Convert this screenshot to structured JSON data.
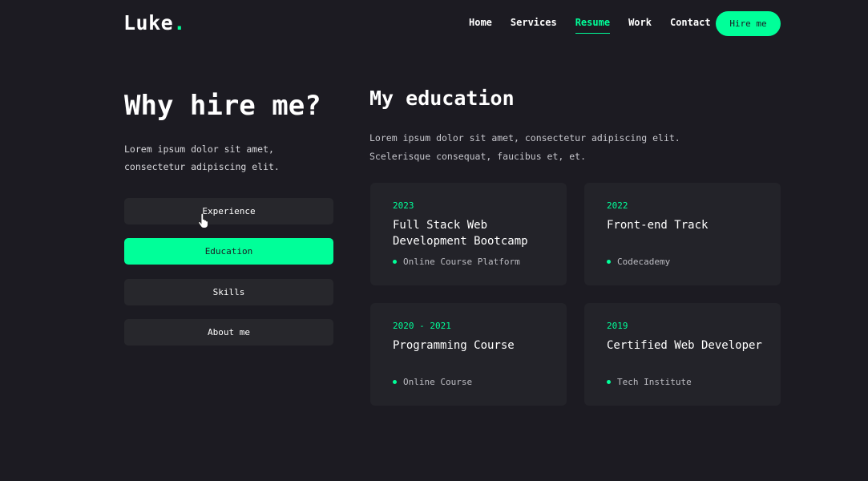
{
  "header": {
    "logo_text": "Luke",
    "logo_dot": ".",
    "nav": [
      {
        "label": "Home"
      },
      {
        "label": "Services"
      },
      {
        "label": "Resume",
        "active": true
      },
      {
        "label": "Work"
      },
      {
        "label": "Contact"
      }
    ],
    "hire_label": "Hire me"
  },
  "sidebar": {
    "title": "Why hire me?",
    "description": "Lorem ipsum dolor sit amet, consectetur adipiscing elit.",
    "tabs": [
      {
        "label": "Experience"
      },
      {
        "label": "Education",
        "active": true
      },
      {
        "label": "Skills"
      },
      {
        "label": "About me"
      }
    ]
  },
  "education": {
    "title": "My education",
    "description": "Lorem ipsum dolor sit amet, consectetur adipiscing elit. Scelerisque consequat, faucibus et, et.",
    "cards": [
      {
        "year": "2023",
        "title": "Full Stack Web Development Bootcamp",
        "institution": "Online Course Platform"
      },
      {
        "year": "2022",
        "title": "Front-end Track",
        "institution": "Codecademy"
      },
      {
        "year": "2020 - 2021",
        "title": "Programming Course",
        "institution": "Online Course"
      },
      {
        "year": "2019",
        "title": "Certified Web Developer",
        "institution": "Tech Institute"
      }
    ]
  },
  "colors": {
    "accent": "#00ff99",
    "background": "#1c1b22",
    "card": "#232329"
  },
  "icons": {
    "cursor": "hand-pointer-icon",
    "bullet": "dot-icon"
  }
}
